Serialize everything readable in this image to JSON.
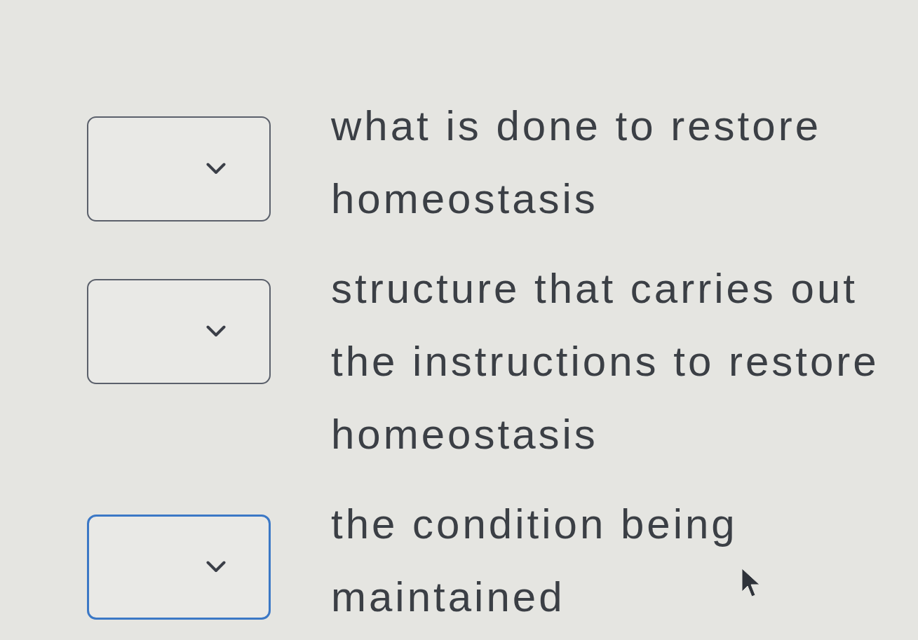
{
  "items": [
    {
      "text": "what is done to restore homeostasis",
      "dropdown": {
        "focused": false
      }
    },
    {
      "text": "structure that carries out the instructions to restore homeostasis",
      "dropdown": {
        "focused": false
      }
    },
    {
      "text": "the condition being maintained",
      "dropdown": {
        "focused": true
      }
    }
  ]
}
